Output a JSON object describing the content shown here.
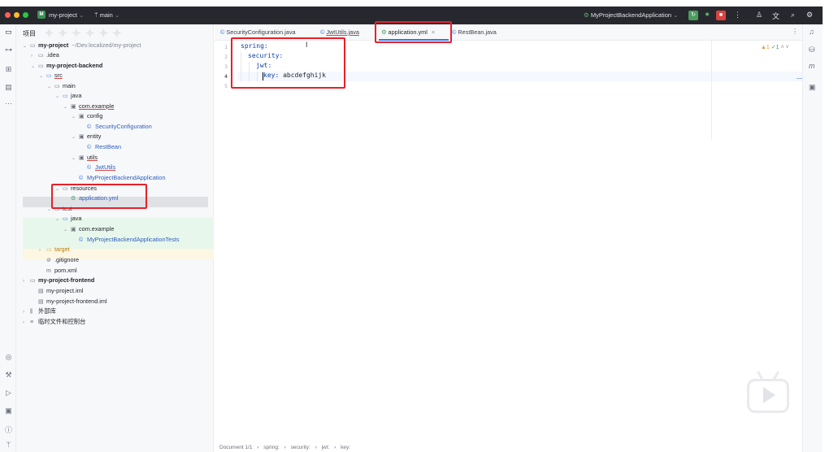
{
  "titlebar": {
    "project_badge": "M",
    "project_name": "my-project",
    "branch": "main",
    "run_config": "MyProjectBackendApplication"
  },
  "project_panel": {
    "header": "项目",
    "tree": [
      {
        "chev": "⌄",
        "icon": "▭",
        "label": "my-project",
        "extra": "~/Dev.localized/my-project",
        "bold": true
      },
      {
        "chev": "›",
        "icon": "▭",
        "label": ".idea",
        "extra": ""
      },
      {
        "chev": "⌄",
        "icon": "▭",
        "label": "my-project-backend",
        "extra": "",
        "bold": true
      },
      {
        "chev": "⌄",
        "icon": "▭",
        "label": "src",
        "extra": ""
      },
      {
        "chev": "⌄",
        "icon": "▭",
        "label": "main",
        "extra": ""
      },
      {
        "chev": "⌄",
        "icon": "▭",
        "label": "java",
        "extra": ""
      },
      {
        "chev": "⌄",
        "icon": "▣",
        "label": "com.example",
        "extra": ""
      },
      {
        "chev": "⌄",
        "icon": "▣",
        "label": "config",
        "extra": ""
      },
      {
        "chev": "",
        "icon": "©",
        "label": "SecurityConfiguration",
        "extra": ""
      },
      {
        "chev": "⌄",
        "icon": "▣",
        "label": "entity",
        "extra": ""
      },
      {
        "chev": "",
        "icon": "©",
        "label": "RestBean",
        "extra": ""
      },
      {
        "chev": "⌄",
        "icon": "▣",
        "label": "utils",
        "extra": ""
      },
      {
        "chev": "",
        "icon": "©",
        "label": "JwtUtils",
        "extra": ""
      },
      {
        "chev": "",
        "icon": "©",
        "label": "MyProjectBackendApplication",
        "extra": ""
      },
      {
        "chev": "⌄",
        "icon": "▭",
        "label": "resources",
        "extra": ""
      },
      {
        "chev": "",
        "icon": "⚙",
        "label": "application.yml",
        "extra": ""
      },
      {
        "chev": "⌄",
        "icon": "▭",
        "label": "test",
        "extra": ""
      },
      {
        "chev": "⌄",
        "icon": "▭",
        "label": "java",
        "extra": ""
      },
      {
        "chev": "⌄",
        "icon": "▣",
        "label": "com.example",
        "extra": ""
      },
      {
        "chev": "",
        "icon": "©",
        "label": "MyProjectBackendApplicationTests",
        "extra": ""
      },
      {
        "chev": "›",
        "icon": "▭",
        "label": "target",
        "extra": ""
      },
      {
        "chev": "",
        "icon": "⊘",
        "label": ".gitignore",
        "extra": ""
      },
      {
        "chev": "",
        "icon": "m",
        "label": "pom.xml",
        "extra": ""
      },
      {
        "chev": "›",
        "icon": "▭",
        "label": "my-project-frontend",
        "extra": "",
        "bold": true
      },
      {
        "chev": "",
        "icon": "▤",
        "label": "my-project.iml",
        "extra": ""
      },
      {
        "chev": "",
        "icon": "▤",
        "label": "my-project-frontend.iml",
        "extra": ""
      },
      {
        "chev": "›",
        "icon": "⫼",
        "label": "外部库",
        "extra": ""
      },
      {
        "chev": "›",
        "icon": "≡",
        "label": "临时文件和控制台",
        "extra": ""
      }
    ]
  },
  "editor": {
    "tabs": [
      {
        "label": "SecurityConfiguration.java",
        "close": ""
      },
      {
        "label": "JwtUtils.java",
        "close": ""
      },
      {
        "label": "application.yml",
        "close": "×"
      },
      {
        "label": "RestBean.java",
        "close": ""
      }
    ],
    "line_numbers": [
      "1",
      "2",
      "3",
      "4",
      "5"
    ],
    "code_lines": [
      {
        "key": "spring:",
        "value": ""
      },
      {
        "key": "security:",
        "value": ""
      },
      {
        "key": "jwt:",
        "value": ""
      },
      {
        "key": "key:",
        "value": " abcdefghijk"
      },
      {
        "key": "",
        "value": ""
      }
    ],
    "inspections": {
      "warnings": "▲1",
      "weak": "✓1"
    }
  },
  "statusbar": {
    "items": [
      "Document 1/1",
      "›",
      "spring:",
      "›",
      "security:",
      "›",
      "jwt:",
      "›",
      "key:"
    ]
  },
  "colors": {
    "annotation": "#e8202a",
    "accent": "#3574f0",
    "yaml_key": "#0a3fa6"
  }
}
